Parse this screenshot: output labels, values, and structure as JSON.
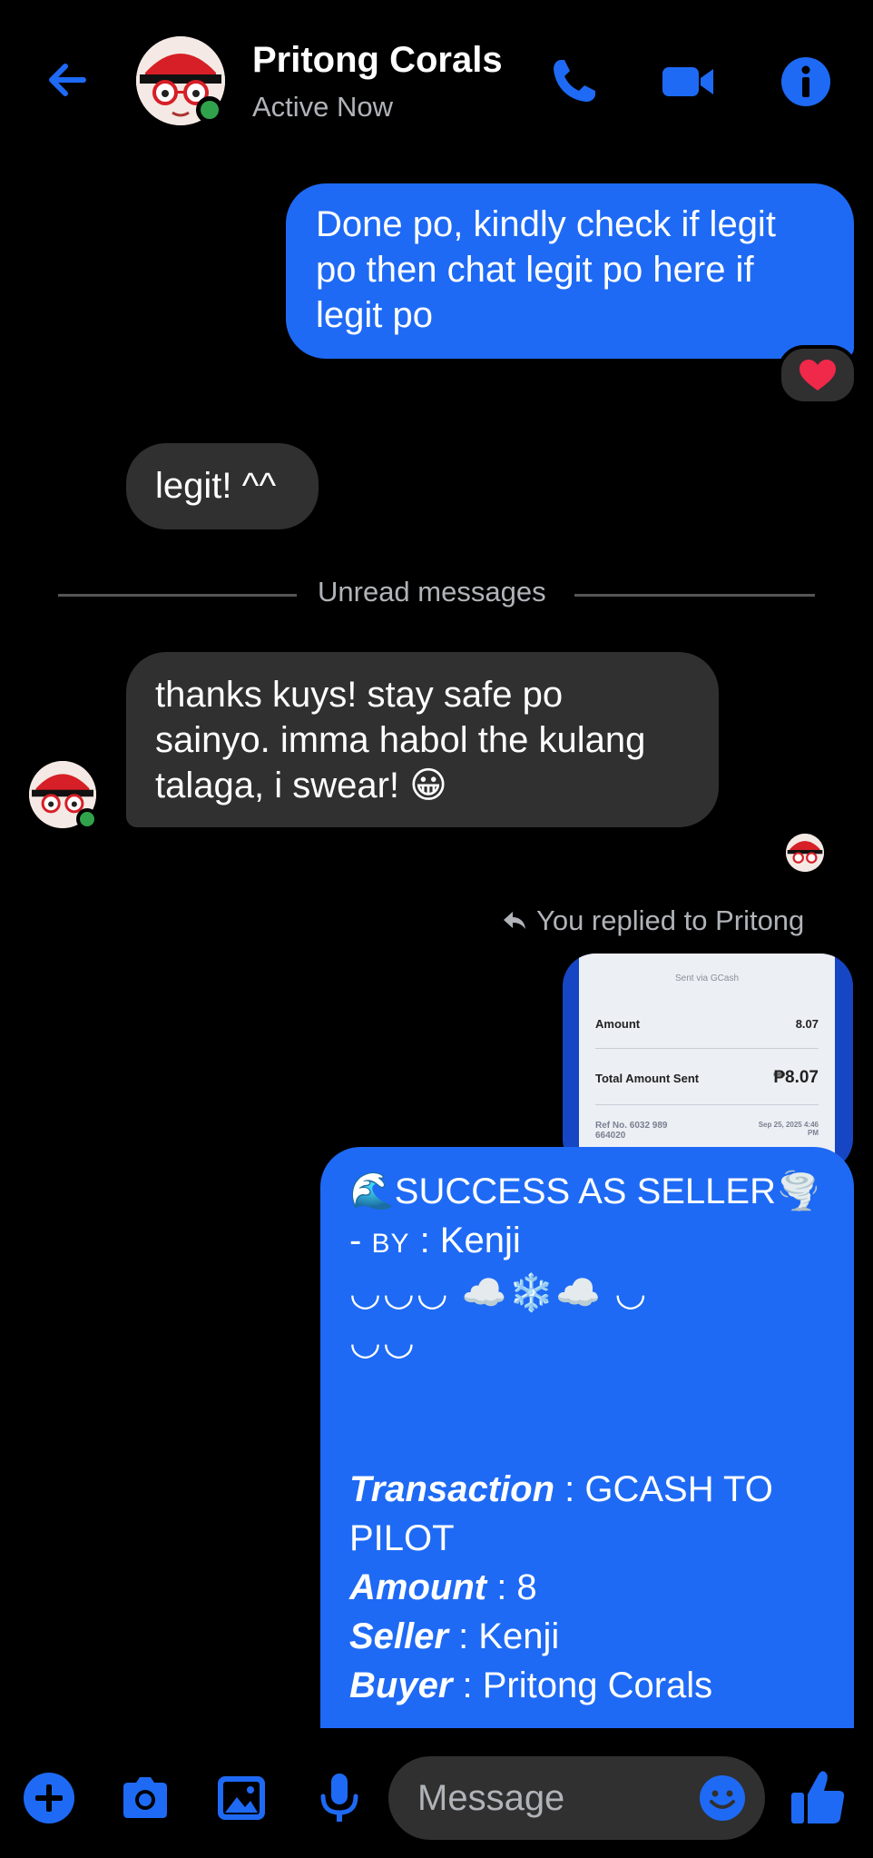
{
  "header": {
    "name": "Pritong Corals",
    "status": "Active Now"
  },
  "messages": {
    "m1": [
      "Done po, kindly check if legit",
      "po then chat legit po here if",
      "legit po"
    ],
    "m1_reaction": "❤️",
    "m2": "legit! ^^",
    "divider": "Unread messages",
    "m3": [
      "thanks kuys! stay safe po",
      "sainyo. imma habol the kulang",
      "talaga, i swear! 😀"
    ],
    "reply_label": "You replied to Pritong"
  },
  "receipt": {
    "sent_via": "Sent via GCash",
    "amount_label": "Amount",
    "amount_value": "8.07",
    "total_label": "Total Amount Sent",
    "total_value": "₱8.07",
    "ref_label": "Ref No. 6032 989",
    "ref_label2": "664020",
    "date": "Sep 25, 2025 4:46",
    "date2": "PM"
  },
  "success": {
    "title": "🌊SUCCESS AS SELLER🌪️",
    "by_prefix": "- ",
    "by_sc": "BY",
    "by_rest": " : Kenji",
    "arcs1": "◡◡◡ ☁️❄️☁️ ◡",
    "arcs2": "◡◡",
    "transaction_label": "Transaction",
    "transaction_value": " : GCASH TO",
    "transaction_value2": "PILOT",
    "amount_label": "Amount",
    "amount_value": " : 8",
    "seller_label": "Seller",
    "seller_value": " : Kenji",
    "buyer_label": "Buyer",
    "buyer_value": " : Pritong Corals"
  },
  "composer": {
    "placeholder": "Message"
  },
  "colors": {
    "accent": "#1e6af5",
    "incoming_bubble": "#303030",
    "online": "#31a24c"
  },
  "icons": [
    "back-arrow-icon",
    "phone-icon",
    "video-camera-icon",
    "info-icon",
    "reply-arrow-icon",
    "plus-icon",
    "camera-icon",
    "image-icon",
    "microphone-icon",
    "emoji-icon",
    "thumbs-up-icon"
  ]
}
